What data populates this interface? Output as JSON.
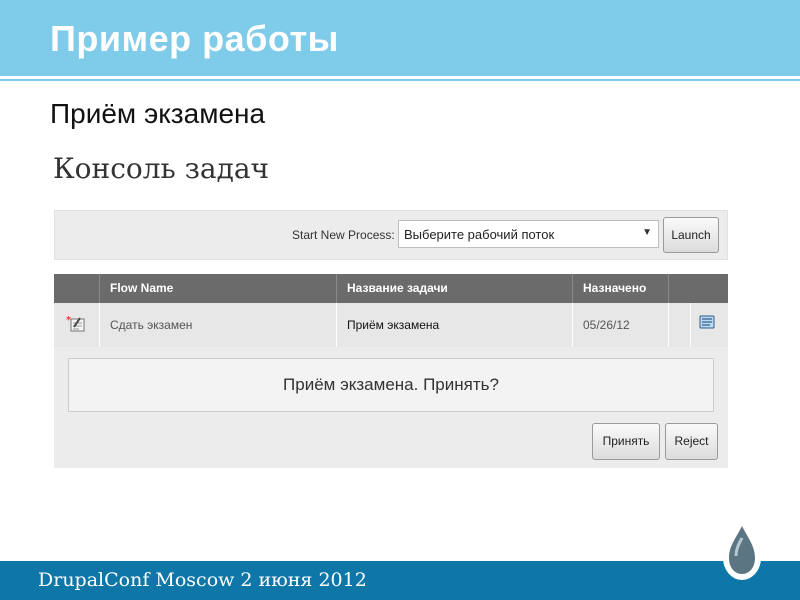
{
  "slide": {
    "title": "Пример работы",
    "subtitle": "Приём экзамена",
    "footer": "DrupalConf Moscow 2 июня 2012"
  },
  "console": {
    "title": "Консоль задач",
    "start_process_label": "Start New Process:",
    "process_select_value": "Выберите рабочий поток",
    "launch_label": "Launch",
    "columns": [
      "Flow Name",
      "Название задачи",
      "Назначено"
    ],
    "rows": [
      {
        "flow_name": "Сдать экзамен",
        "task_name": "Приём экзамена",
        "assigned": "05/26/12"
      }
    ],
    "question": "Приём экзамена. Принять?",
    "accept_label": "Принять",
    "reject_label": "Reject"
  },
  "icons": {
    "task": "task-edit-icon",
    "edit": "notepad-icon",
    "logo": "water-drop-icon"
  },
  "colors": {
    "header": "#7fcbea",
    "footer": "#0f77a8",
    "table_header": "#6b6b6b"
  }
}
